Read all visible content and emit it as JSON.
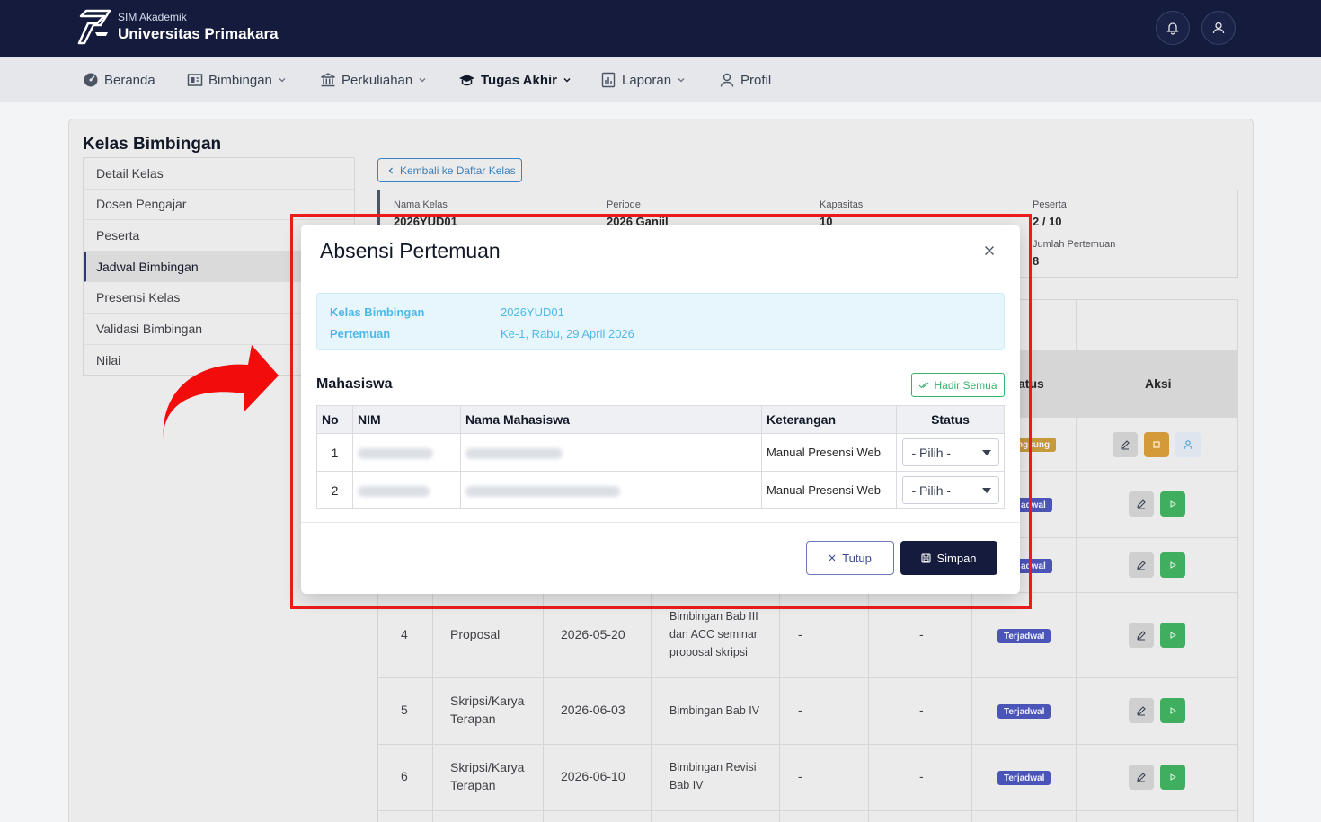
{
  "header": {
    "brand_sub": "SIM Akademik",
    "brand_title": "Universitas Primakara"
  },
  "nav": {
    "items": [
      {
        "label": "Beranda",
        "icon": "dashboard-icon",
        "dropdown": false
      },
      {
        "label": "Bimbingan",
        "icon": "book-icon",
        "dropdown": true
      },
      {
        "label": "Perkuliahan",
        "icon": "institution-icon",
        "dropdown": true
      },
      {
        "label": "Tugas Akhir",
        "icon": "graduation-cap-icon",
        "dropdown": true,
        "active": true
      },
      {
        "label": "Laporan",
        "icon": "report-icon",
        "dropdown": true
      },
      {
        "label": "Profil",
        "icon": "user-icon",
        "dropdown": false
      }
    ]
  },
  "page": {
    "title": "Kelas Bimbingan",
    "side_menu": [
      "Detail Kelas",
      "Dosen Pengajar",
      "Peserta",
      "Jadwal Bimbingan",
      "Presensi Kelas",
      "Validasi Bimbingan",
      "Nilai"
    ],
    "side_active": "Jadwal Bimbingan",
    "back_label": "Kembali ke Daftar Kelas",
    "info": {
      "nama_kelas_label": "Nama Kelas",
      "nama_kelas": "2026YUD01",
      "periode_label": "Periode",
      "periode": "2026 Ganjil",
      "kapasitas_label": "Kapasitas",
      "kapasitas": "10",
      "peserta_label": "Peserta",
      "peserta": "2 / 10",
      "jumlah_label": "Jumlah Pertemuan",
      "jumlah": "8"
    }
  },
  "schedule": {
    "status_header_fragment": "atus",
    "aksi_header": "Aksi",
    "rows": [
      {
        "no": "4",
        "tahap": "Proposal",
        "tanggal": "2026-05-20",
        "materi": "Bimbingan Bab III dan ACC seminar proposal skripsi",
        "c1": "-",
        "c2": "-",
        "status": "Terjadwal"
      },
      {
        "no": "5",
        "tahap": "Skripsi/Karya Terapan",
        "tanggal": "2026-06-03",
        "materi": "Bimbingan Bab IV",
        "c1": "-",
        "c2": "-",
        "status": "Terjadwal"
      },
      {
        "no": "6",
        "tahap": "Skripsi/Karya Terapan",
        "tanggal": "2026-06-10",
        "materi": "Bimbingan Revisi Bab IV",
        "c1": "-",
        "c2": "-",
        "status": "Terjadwal"
      }
    ],
    "partial_badges": [
      "ngsung",
      "adwal",
      "adwal"
    ]
  },
  "modal": {
    "title": "Absensi Pertemuan",
    "kelas_label": "Kelas Bimbingan",
    "kelas_value": "2026YUD01",
    "pertemuan_label": "Pertemuan",
    "pertemuan_value": "Ke-1, Rabu, 29 April 2026",
    "section_title": "Mahasiswa",
    "hadir_semua": "Hadir Semua",
    "columns": [
      "No",
      "NIM",
      "Nama Mahasiswa",
      "Keterangan",
      "Status"
    ],
    "rows": [
      {
        "no": "1",
        "keterangan": "Manual Presensi Web",
        "status": "- Pilih -"
      },
      {
        "no": "2",
        "keterangan": "Manual Presensi Web",
        "status": "- Pilih -"
      }
    ],
    "tutup": "Tutup",
    "simpan": "Simpan"
  },
  "colors": {
    "header_bg": "#141b3c",
    "highlight": "#ee1c1c",
    "accent_info": "#4fb8e6",
    "success": "#39b36a",
    "badge_blue": "#4b55b8"
  }
}
